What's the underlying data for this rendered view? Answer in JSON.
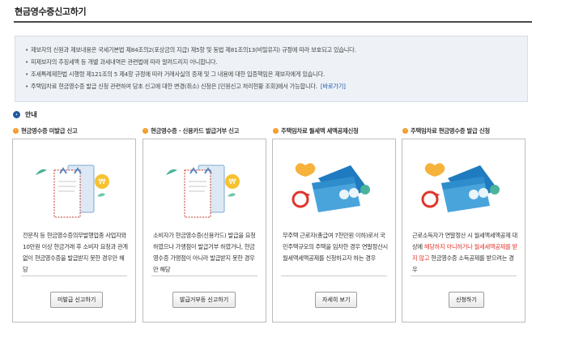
{
  "page": {
    "title": "현금영수증신고하기"
  },
  "notice": {
    "lines": [
      "제보자의 신원과 제보내용은 국세기본법 제84조의2(포상금의 지급) 제5항 및 동법 제81조의13(비밀유지) 규정에 따라 보호되고 있습니다.",
      "피제보자의 추징세액 등 개별 과세내역은 관련법에 따라 알려드리지 아니합니다.",
      "조세특례제한법 시행령 제121조의 5 제4항 규정에 따라 거래사실의 증재 및 그 내용에 대한 입증책임은 제보자에게 있습니다.",
      "주택임차료 현금영수증 발급 신청 관련하여 당초 신고에 대한 변경(취소) 신청은 [민원신고 처리현황 조회]에서 가능합니다."
    ],
    "link_label": "[바로가기]"
  },
  "guide": {
    "label": "안내"
  },
  "cards": [
    {
      "heading": "현금영수증 미발급 신고",
      "desc": "전문직 등 현금영수증의무발행업종 사업자와 10만원 이상 현금거래 후 소비자 요청과 관계 없이 현금영수증을 발급받지 못한 경우만 해당",
      "button": "미발급 신고하기"
    },
    {
      "heading": "현금영수증 · 신용카드 발급거부 신고",
      "desc": "소비자가 현금영수증(신용카드) 발급을 요청하였으나 가맹점이 발급거부 하였거나, 현금영수증 가맹점이 아니라 발급받지 못한 경우만 해당",
      "button": "발급거부등 신고하기"
    },
    {
      "heading": "주택임차료 월세액 세액공제신청",
      "desc": "무주택 근로자(총급여 7천만원 이하)로서 국민주택규모의 주택을 임차한 경우 연말정산시 월세액세액공제를 신청하고자 하는 경우",
      "button": "자세히 보기"
    },
    {
      "heading": "주택임차료 현금영수증 발급 신청",
      "desc_a": "근로소득자가 연말정산 시 월세액세액공제 대상에 ",
      "desc_red": "해당하지 아니하거나 월세세액공제를 받지 않고",
      "desc_b": " 현금영수증 소득공제를 받으려는 경우",
      "button": "신청하기"
    }
  ],
  "colors": {
    "accent_blue": "#1e5a9e",
    "accent_orange": "#f39a2a",
    "highlight_red": "#e0352b",
    "notice_bg": "#eef2f6"
  }
}
